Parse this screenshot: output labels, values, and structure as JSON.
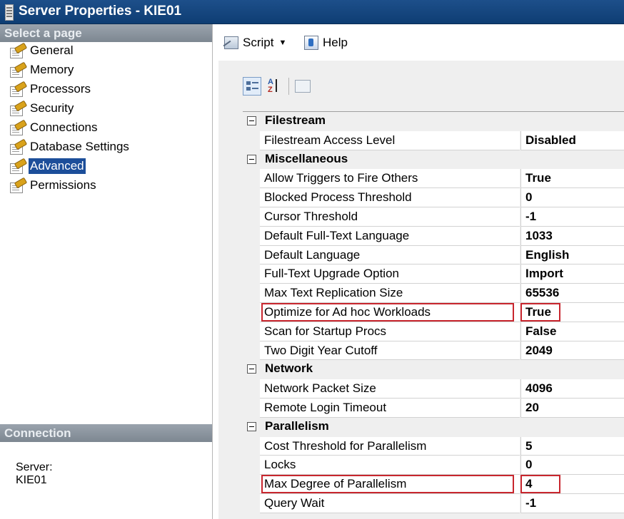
{
  "window": {
    "title": "Server Properties - KIE01"
  },
  "sidebar": {
    "header": "Select a page",
    "items": [
      {
        "label": "General",
        "selected": false
      },
      {
        "label": "Memory",
        "selected": false
      },
      {
        "label": "Processors",
        "selected": false
      },
      {
        "label": "Security",
        "selected": false
      },
      {
        "label": "Connections",
        "selected": false
      },
      {
        "label": "Database Settings",
        "selected": false
      },
      {
        "label": "Advanced",
        "selected": true
      },
      {
        "label": "Permissions",
        "selected": false
      }
    ],
    "connection_header": "Connection",
    "server_label": "Server:",
    "server_value": "KIE01"
  },
  "toolbar": {
    "script_label": "Script",
    "help_label": "Help"
  },
  "grid": {
    "categories": [
      {
        "name": "Filestream",
        "rows": [
          {
            "name": "Filestream Access Level",
            "value": "Disabled"
          }
        ]
      },
      {
        "name": "Miscellaneous",
        "rows": [
          {
            "name": "Allow Triggers to Fire Others",
            "value": "True"
          },
          {
            "name": "Blocked Process Threshold",
            "value": "0"
          },
          {
            "name": "Cursor Threshold",
            "value": "-1"
          },
          {
            "name": "Default Full-Text Language",
            "value": "1033"
          },
          {
            "name": "Default Language",
            "value": "English"
          },
          {
            "name": "Full-Text Upgrade Option",
            "value": "Import"
          },
          {
            "name": "Max Text Replication Size",
            "value": "65536"
          },
          {
            "name": "Optimize for Ad hoc Workloads",
            "value": "True",
            "highlighted": true
          },
          {
            "name": "Scan for Startup Procs",
            "value": "False"
          },
          {
            "name": "Two Digit Year Cutoff",
            "value": "2049"
          }
        ]
      },
      {
        "name": "Network",
        "rows": [
          {
            "name": "Network Packet Size",
            "value": "4096"
          },
          {
            "name": "Remote Login Timeout",
            "value": "20"
          }
        ]
      },
      {
        "name": "Parallelism",
        "rows": [
          {
            "name": "Cost Threshold for Parallelism",
            "value": "5"
          },
          {
            "name": "Locks",
            "value": "0"
          },
          {
            "name": "Max Degree of Parallelism",
            "value": "4",
            "highlighted": true
          },
          {
            "name": "Query Wait",
            "value": "-1"
          }
        ]
      }
    ]
  },
  "colors": {
    "title_bar": "#0e3d73",
    "selection": "#1c4e9a",
    "highlight_box": "#c8262e",
    "pane_header": "#8a939c"
  }
}
